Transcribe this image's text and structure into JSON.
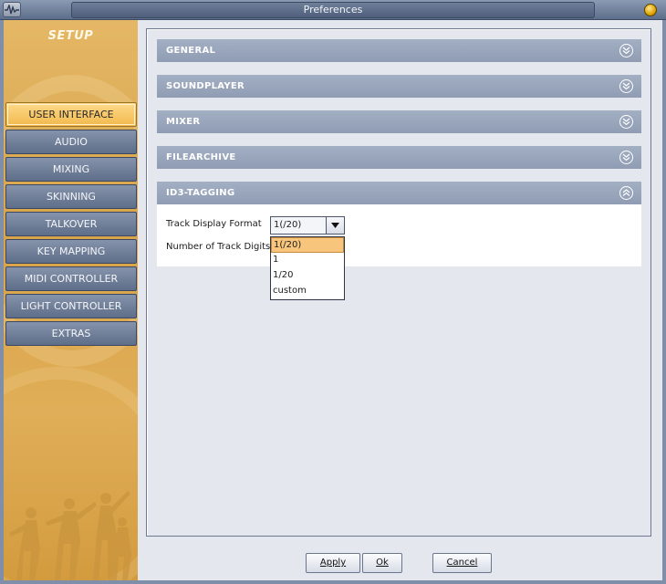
{
  "window": {
    "title": "Preferences",
    "app_icon": "waveform-icon",
    "close_icon": "close-orb-icon"
  },
  "sidebar": {
    "heading": "SETUP",
    "items": [
      {
        "label": "USER INTERFACE",
        "active": true
      },
      {
        "label": "AUDIO"
      },
      {
        "label": "MIXING"
      },
      {
        "label": "SKINNING"
      },
      {
        "label": "TALKOVER"
      },
      {
        "label": "KEY MAPPING"
      },
      {
        "label": "MIDI CONTROLLER"
      },
      {
        "label": "LIGHT CONTROLLER"
      },
      {
        "label": "EXTRAS"
      }
    ]
  },
  "sections": [
    {
      "title": "GENERAL",
      "expanded": false
    },
    {
      "title": "SOUNDPLAYER",
      "expanded": false
    },
    {
      "title": "MIXER",
      "expanded": false
    },
    {
      "title": "FILEARCHIVE",
      "expanded": false
    },
    {
      "title": "ID3-TAGGING",
      "expanded": true
    }
  ],
  "id3": {
    "track_display_format_label": "Track Display Format",
    "track_display_format_value": "1(/20)",
    "number_of_track_digits_label": "Number of Track Digits",
    "format_options": [
      "1(/20)",
      "1",
      "1/20",
      "custom"
    ],
    "selected_option": "1(/20)"
  },
  "buttons": {
    "apply": "Apply",
    "ok": "Ok",
    "cancel": "Cancel"
  },
  "colors": {
    "accent": "#f7c67c",
    "section_header": "#97a4b9",
    "sidebar": "#dca650"
  }
}
